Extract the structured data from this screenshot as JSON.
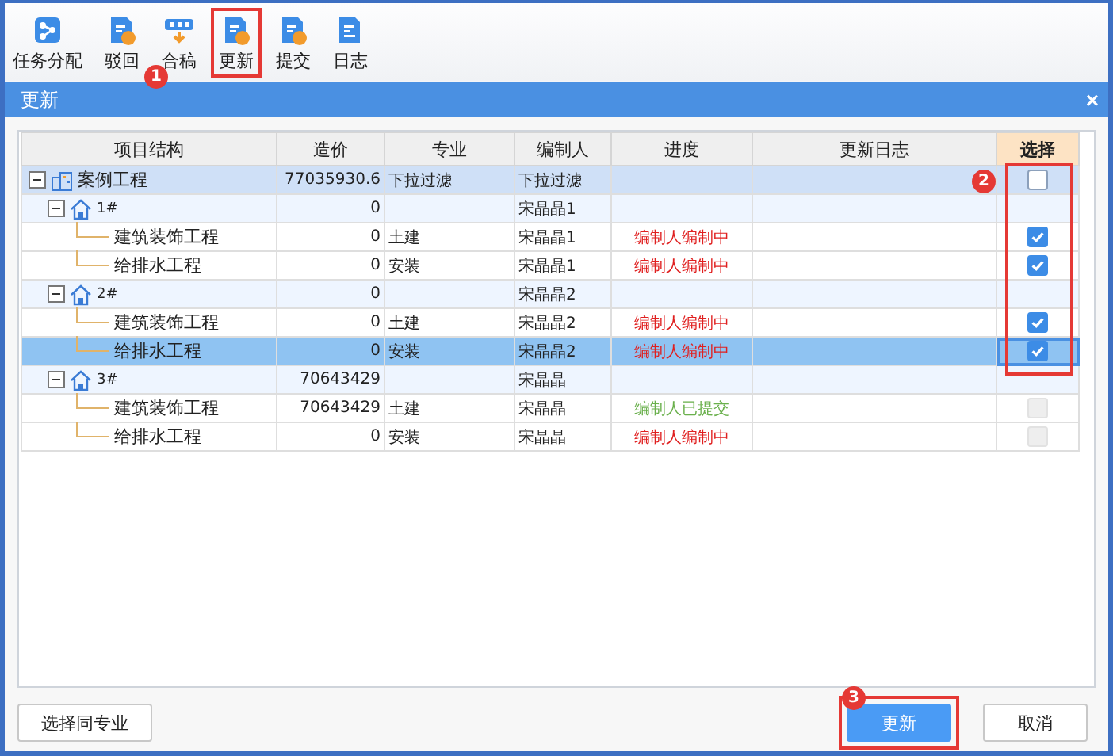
{
  "toolbar": [
    {
      "label": "任务分配",
      "highlighted": false
    },
    {
      "label": "驳回",
      "highlighted": false
    },
    {
      "label": "合稿",
      "highlighted": false
    },
    {
      "label": "更新",
      "highlighted": true
    },
    {
      "label": "提交",
      "highlighted": false
    },
    {
      "label": "日志",
      "highlighted": false
    }
  ],
  "dialog": {
    "title": "更新",
    "close": "×"
  },
  "table": {
    "columns": [
      "项目结构",
      "造价",
      "专业",
      "编制人",
      "进度",
      "更新日志",
      "选择"
    ],
    "rows": [
      {
        "kind": "project",
        "name": "案例工程",
        "cost": "77035930.6",
        "specialty": "下拉过滤",
        "editor": "下拉过滤",
        "expanded": true,
        "selected": false,
        "checkbox": {
          "checked": false,
          "disabled": false
        },
        "children": [
          {
            "kind": "building",
            "name": "1#",
            "cost": "0",
            "editor": "宋晶晶1",
            "expanded": true,
            "selected": false,
            "children": [
              {
                "name": "建筑装饰工程",
                "cost": "0",
                "specialty": "土建",
                "editor": "宋晶晶1",
                "progress": {
                  "text": "编制人编制中",
                  "kind": "editing"
                },
                "selected": false,
                "checkbox": {
                  "checked": true,
                  "disabled": false
                }
              },
              {
                "name": "给排水工程",
                "cost": "0",
                "specialty": "安装",
                "editor": "宋晶晶1",
                "progress": {
                  "text": "编制人编制中",
                  "kind": "editing"
                },
                "selected": false,
                "checkbox": {
                  "checked": true,
                  "disabled": false
                }
              }
            ]
          },
          {
            "kind": "building",
            "name": "2#",
            "cost": "0",
            "editor": "宋晶晶2",
            "expanded": true,
            "selected": false,
            "children": [
              {
                "name": "建筑装饰工程",
                "cost": "0",
                "specialty": "土建",
                "editor": "宋晶晶2",
                "progress": {
                  "text": "编制人编制中",
                  "kind": "editing"
                },
                "selected": false,
                "checkbox": {
                  "checked": true,
                  "disabled": false
                }
              },
              {
                "name": "给排水工程",
                "cost": "0",
                "specialty": "安装",
                "editor": "宋晶晶2",
                "progress": {
                  "text": "编制人编制中",
                  "kind": "editing"
                },
                "selected": true,
                "checkbox": {
                  "checked": true,
                  "disabled": false
                }
              }
            ]
          },
          {
            "kind": "building",
            "name": "3#",
            "cost": "70643429",
            "editor": "宋晶晶",
            "expanded": true,
            "selected": false,
            "children": [
              {
                "name": "建筑装饰工程",
                "cost": "70643429",
                "specialty": "土建",
                "editor": "宋晶晶",
                "progress": {
                  "text": "编制人已提交",
                  "kind": "submitted"
                },
                "selected": false,
                "checkbox": {
                  "checked": false,
                  "disabled": true
                }
              },
              {
                "name": "给排水工程",
                "cost": "0",
                "specialty": "安装",
                "editor": "宋晶晶",
                "progress": {
                  "text": "编制人编制中",
                  "kind": "editing"
                },
                "selected": false,
                "checkbox": {
                  "checked": false,
                  "disabled": true
                }
              }
            ]
          }
        ]
      }
    ]
  },
  "footer": {
    "left_button": "选择同专业",
    "buttons": [
      {
        "label": "更新",
        "primary": true,
        "highlighted": true
      },
      {
        "label": "取消",
        "primary": false,
        "highlighted": false
      }
    ]
  },
  "annotations": [
    "1",
    "2",
    "3"
  ]
}
